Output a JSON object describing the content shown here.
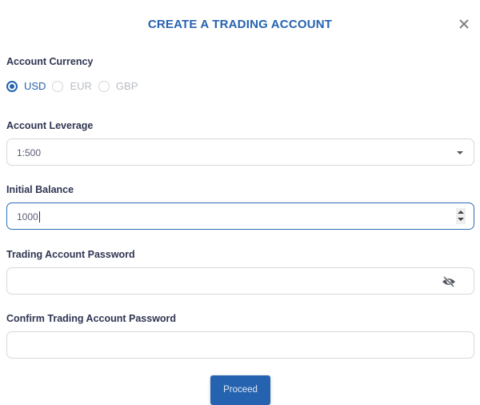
{
  "dialog": {
    "title": "CREATE A TRADING ACCOUNT",
    "close_icon": "close-icon"
  },
  "currency": {
    "label": "Account Currency",
    "options": [
      {
        "label": "USD",
        "checked": true
      },
      {
        "label": "EUR",
        "checked": false
      },
      {
        "label": "GBP",
        "checked": false
      }
    ]
  },
  "leverage": {
    "label": "Account Leverage",
    "value": "1:500",
    "icon": "chevron-down-icon"
  },
  "balance": {
    "label": "Initial Balance",
    "value": "1000"
  },
  "password": {
    "label": "Trading Account Password",
    "value": "",
    "icon": "eye-slash-icon"
  },
  "confirm_password": {
    "label": "Confirm Trading Account Password",
    "value": ""
  },
  "actions": {
    "proceed_label": "Proceed"
  },
  "colors": {
    "accent": "#2563b0",
    "label_text": "#2f3552"
  }
}
